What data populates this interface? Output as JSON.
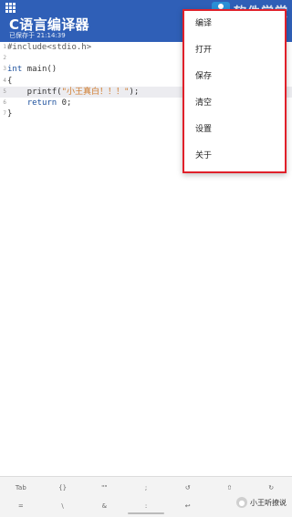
{
  "appbar": {
    "title": "C语言编译器",
    "subtitle": "已保存于 21:14:39",
    "logo_text": "软件学堂"
  },
  "editor": {
    "lines": [
      {
        "num": "1",
        "parts": [
          {
            "t": "#include",
            "c": "pp"
          },
          {
            "t": "<stdio.h>",
            "c": "pp"
          }
        ]
      },
      {
        "num": "2",
        "parts": []
      },
      {
        "num": "3",
        "parts": [
          {
            "t": "int",
            "c": "kw"
          },
          {
            "t": " main()",
            "c": ""
          }
        ]
      },
      {
        "num": "4",
        "parts": [
          {
            "t": "{",
            "c": ""
          }
        ]
      },
      {
        "num": "5",
        "parts": [
          {
            "t": "    printf(",
            "c": ""
          },
          {
            "t": "\"小王真白！！！\"",
            "c": "str"
          },
          {
            "t": ");",
            "c": ""
          }
        ]
      },
      {
        "num": "6",
        "parts": [
          {
            "t": "    ",
            "c": ""
          },
          {
            "t": "return",
            "c": "kw"
          },
          {
            "t": " 0;",
            "c": ""
          }
        ]
      },
      {
        "num": "7",
        "parts": [
          {
            "t": "}",
            "c": ""
          }
        ]
      }
    ]
  },
  "menu": {
    "items": [
      "编译",
      "打开",
      "保存",
      "清空",
      "设置",
      "关于"
    ]
  },
  "toolbar": {
    "row1": [
      "Tab",
      "{}",
      "\"\"",
      ";",
      "↺",
      "⇧",
      "↻"
    ],
    "row2": [
      "=",
      "\\",
      "&",
      ":",
      "↩",
      "",
      ""
    ]
  },
  "watermark": {
    "text": "小王听撩说"
  },
  "colors": {
    "appbar": "#2f5fb7",
    "menu_border": "#e0202a",
    "keyword": "#1b4f9c",
    "string": "#d07a2a"
  }
}
